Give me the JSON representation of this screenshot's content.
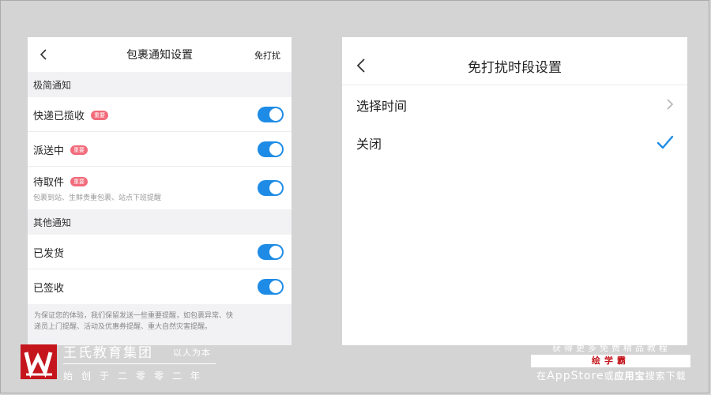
{
  "left_panel": {
    "nav": {
      "title": "包裹通知设置",
      "action": "免打扰"
    },
    "sections": [
      {
        "header": "极简通知",
        "items": [
          {
            "label": "快递已揽收",
            "badge": "重要",
            "toggle_on": true
          },
          {
            "label": "派送中",
            "badge": "重要",
            "toggle_on": true
          },
          {
            "label": "待取件",
            "badge": "重要",
            "subtext": "包裹到站、生鲜贵重包裹、站点下班提醒",
            "toggle_on": true
          }
        ]
      },
      {
        "header": "其他通知",
        "items": [
          {
            "label": "已发货",
            "toggle_on": true
          },
          {
            "label": "已签收",
            "toggle_on": true
          }
        ]
      }
    ],
    "footer_line1": "为保证您的体验，我们保留发送一些重要提醒，如包裹异常、快",
    "footer_line2": "递员上门提醒、活动及优惠券提醒、重大自然灾害提醒。"
  },
  "right_panel": {
    "nav": {
      "title": "免打扰时段设置"
    },
    "options": [
      {
        "label": "选择时间",
        "indicator": "chevron-right-icon"
      },
      {
        "label": "关闭",
        "indicator": "checkmark-icon",
        "selected": true
      }
    ]
  },
  "watermark_left": {
    "brand": "王氏教育集团",
    "slogan": "以人为本",
    "subtitle": "始创于二零零二年"
  },
  "watermark_right": {
    "top": "获得更多免费精品教程",
    "middle": "绘学霸",
    "bottom_pre": "在",
    "bottom_store": "AppStore",
    "bottom_or": "或",
    "bottom_app": "应用宝",
    "bottom_post": "搜索下载"
  },
  "colors": {
    "toggle_on": "#1e8ce6",
    "badge": "#f26b7b",
    "check": "#1e8ce6",
    "logo": "#c4161c"
  }
}
